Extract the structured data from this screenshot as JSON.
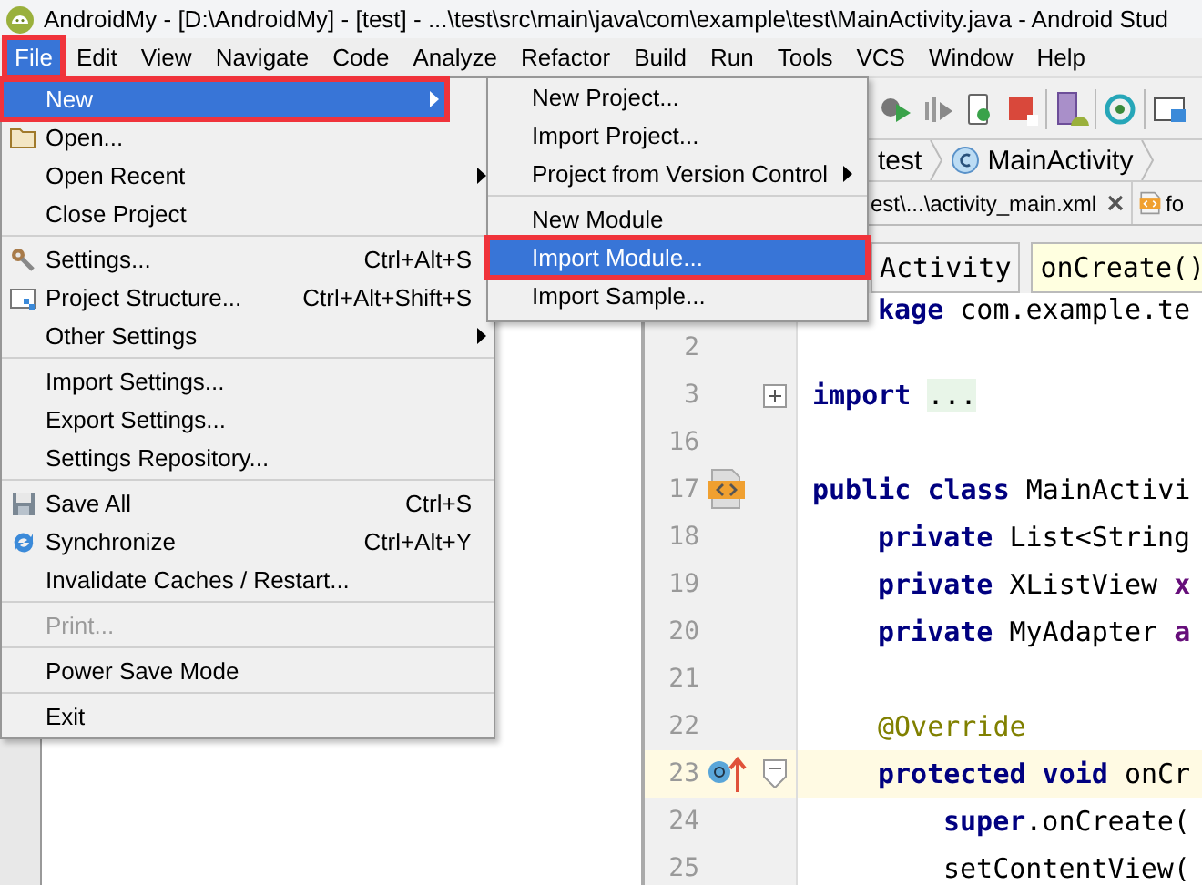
{
  "window": {
    "title": "AndroidMy - [D:\\AndroidMy] - [test] - ...\\test\\src\\main\\java\\com\\example\\test\\MainActivity.java - Android Stud"
  },
  "menubar": [
    {
      "label": "File",
      "selected": true,
      "highlighted": true
    },
    {
      "label": "Edit",
      "selected": false,
      "highlighted": false
    },
    {
      "label": "View",
      "selected": false,
      "highlighted": false
    },
    {
      "label": "Navigate",
      "selected": false,
      "highlighted": false
    },
    {
      "label": "Code",
      "selected": false,
      "highlighted": false
    },
    {
      "label": "Analyze",
      "selected": false,
      "highlighted": false
    },
    {
      "label": "Refactor",
      "selected": false,
      "highlighted": false
    },
    {
      "label": "Build",
      "selected": false,
      "highlighted": false
    },
    {
      "label": "Run",
      "selected": false,
      "highlighted": false
    },
    {
      "label": "Tools",
      "selected": false,
      "highlighted": false
    },
    {
      "label": "VCS",
      "selected": false,
      "highlighted": false
    },
    {
      "label": "Window",
      "selected": false,
      "highlighted": false
    },
    {
      "label": "Help",
      "selected": false,
      "highlighted": false
    }
  ],
  "file_menu": [
    {
      "kind": "item",
      "label": "New",
      "submenu": true,
      "selected": true,
      "highlighted": true,
      "disabled": false
    },
    {
      "kind": "item",
      "label": "Open...",
      "submenu": false,
      "selected": false,
      "highlighted": false,
      "disabled": false
    },
    {
      "kind": "item",
      "label": "Open Recent",
      "submenu": true,
      "selected": false,
      "highlighted": false,
      "disabled": false
    },
    {
      "kind": "item",
      "label": "Close Project",
      "submenu": false,
      "selected": false,
      "highlighted": false,
      "disabled": false
    },
    {
      "kind": "separator"
    },
    {
      "kind": "item",
      "label": "Settings...",
      "shortcut": "Ctrl+Alt+S",
      "submenu": false,
      "selected": false,
      "highlighted": false,
      "disabled": false
    },
    {
      "kind": "item",
      "label": "Project Structure...",
      "shortcut": "Ctrl+Alt+Shift+S",
      "submenu": false,
      "selected": false,
      "highlighted": false,
      "disabled": false
    },
    {
      "kind": "item",
      "label": "Other Settings",
      "submenu": true,
      "selected": false,
      "highlighted": false,
      "disabled": false
    },
    {
      "kind": "separator"
    },
    {
      "kind": "item",
      "label": "Import Settings...",
      "submenu": false,
      "selected": false,
      "highlighted": false,
      "disabled": false
    },
    {
      "kind": "item",
      "label": "Export Settings...",
      "submenu": false,
      "selected": false,
      "highlighted": false,
      "disabled": false
    },
    {
      "kind": "item",
      "label": "Settings Repository...",
      "submenu": false,
      "selected": false,
      "highlighted": false,
      "disabled": false
    },
    {
      "kind": "separator"
    },
    {
      "kind": "item",
      "label": "Save All",
      "shortcut": "Ctrl+S",
      "submenu": false,
      "selected": false,
      "highlighted": false,
      "disabled": false
    },
    {
      "kind": "item",
      "label": "Synchronize",
      "shortcut": "Ctrl+Alt+Y",
      "submenu": false,
      "selected": false,
      "highlighted": false,
      "disabled": false
    },
    {
      "kind": "item",
      "label": "Invalidate Caches / Restart...",
      "submenu": false,
      "selected": false,
      "highlighted": false,
      "disabled": false
    },
    {
      "kind": "separator"
    },
    {
      "kind": "item",
      "label": "Print...",
      "submenu": false,
      "selected": false,
      "highlighted": false,
      "disabled": true
    },
    {
      "kind": "separator"
    },
    {
      "kind": "item",
      "label": "Power Save Mode",
      "submenu": false,
      "selected": false,
      "highlighted": false,
      "disabled": false
    },
    {
      "kind": "separator"
    },
    {
      "kind": "item",
      "label": "Exit",
      "submenu": false,
      "selected": false,
      "highlighted": false,
      "disabled": false
    }
  ],
  "new_submenu": [
    {
      "kind": "item",
      "label": "New Project...",
      "submenu": false,
      "selected": false,
      "highlighted": false
    },
    {
      "kind": "item",
      "label": "Import Project...",
      "submenu": false,
      "selected": false,
      "highlighted": false
    },
    {
      "kind": "item",
      "label": "Project from Version Control",
      "submenu": true,
      "selected": false,
      "highlighted": false
    },
    {
      "kind": "separator"
    },
    {
      "kind": "item",
      "label": "New Module",
      "submenu": false,
      "selected": false,
      "highlighted": false
    },
    {
      "kind": "item",
      "label": "Import Module...",
      "submenu": false,
      "selected": true,
      "highlighted": true
    },
    {
      "kind": "item",
      "label": "Import Sample...",
      "submenu": false,
      "selected": false,
      "highlighted": false
    }
  ],
  "breadcrumbs": [
    {
      "label": "test"
    },
    {
      "label": "MainActivity"
    }
  ],
  "editor_tabs": [
    {
      "label": "est\\...\\activity_main.xml",
      "closable": true
    },
    {
      "label": "fo",
      "closable": false
    }
  ],
  "navigation": [
    {
      "label": "Activity",
      "current": false
    },
    {
      "label": "onCreate()",
      "current": true
    }
  ],
  "code": {
    "partial_line": [
      {
        "kind": "keyword",
        "text": "kage"
      },
      {
        "kind": "plain",
        "text": " com.example.te"
      }
    ],
    "lines": [
      {
        "number": "2",
        "kind": "blank",
        "current": false
      },
      {
        "number": "3",
        "kind": "top",
        "current": false,
        "segments": [
          {
            "kind": "keyword",
            "text": "import"
          },
          {
            "kind": "folded",
            "text": "..."
          }
        ]
      },
      {
        "number": "16",
        "kind": "blank",
        "current": false
      },
      {
        "number": "17",
        "kind": "top",
        "current": false,
        "segments": [
          {
            "kind": "keyword",
            "text": "public class"
          },
          {
            "kind": "plain",
            "text": " MainActivi"
          }
        ]
      },
      {
        "number": "18",
        "kind": "member",
        "current": false,
        "segments": [
          {
            "kind": "keyword",
            "text": "private"
          },
          {
            "kind": "plain",
            "text": " List<String"
          }
        ]
      },
      {
        "number": "19",
        "kind": "member",
        "current": false,
        "segments": [
          {
            "kind": "keyword",
            "text": "private"
          },
          {
            "kind": "plain",
            "text": " XListView "
          },
          {
            "kind": "field",
            "text": "x"
          }
        ]
      },
      {
        "number": "20",
        "kind": "member",
        "current": false,
        "segments": [
          {
            "kind": "keyword",
            "text": "private"
          },
          {
            "kind": "plain",
            "text": " MyAdapter "
          },
          {
            "kind": "field",
            "text": "a"
          }
        ]
      },
      {
        "number": "21",
        "kind": "blank",
        "current": false
      },
      {
        "number": "22",
        "kind": "member",
        "current": false,
        "segments": [
          {
            "kind": "annotation",
            "text": "@Override"
          }
        ]
      },
      {
        "number": "23",
        "kind": "member",
        "current": true,
        "segments": [
          {
            "kind": "keyword",
            "text": "protected void"
          },
          {
            "kind": "plain",
            "text": " onCr"
          }
        ]
      },
      {
        "number": "24",
        "kind": "body",
        "current": false,
        "segments": [
          {
            "kind": "keyword",
            "text": "super"
          },
          {
            "kind": "plain",
            "text": ".onCreate("
          }
        ]
      },
      {
        "number": "25",
        "kind": "body",
        "current": false,
        "segments": [
          {
            "kind": "plain",
            "text": "setContentView("
          }
        ]
      }
    ]
  }
}
